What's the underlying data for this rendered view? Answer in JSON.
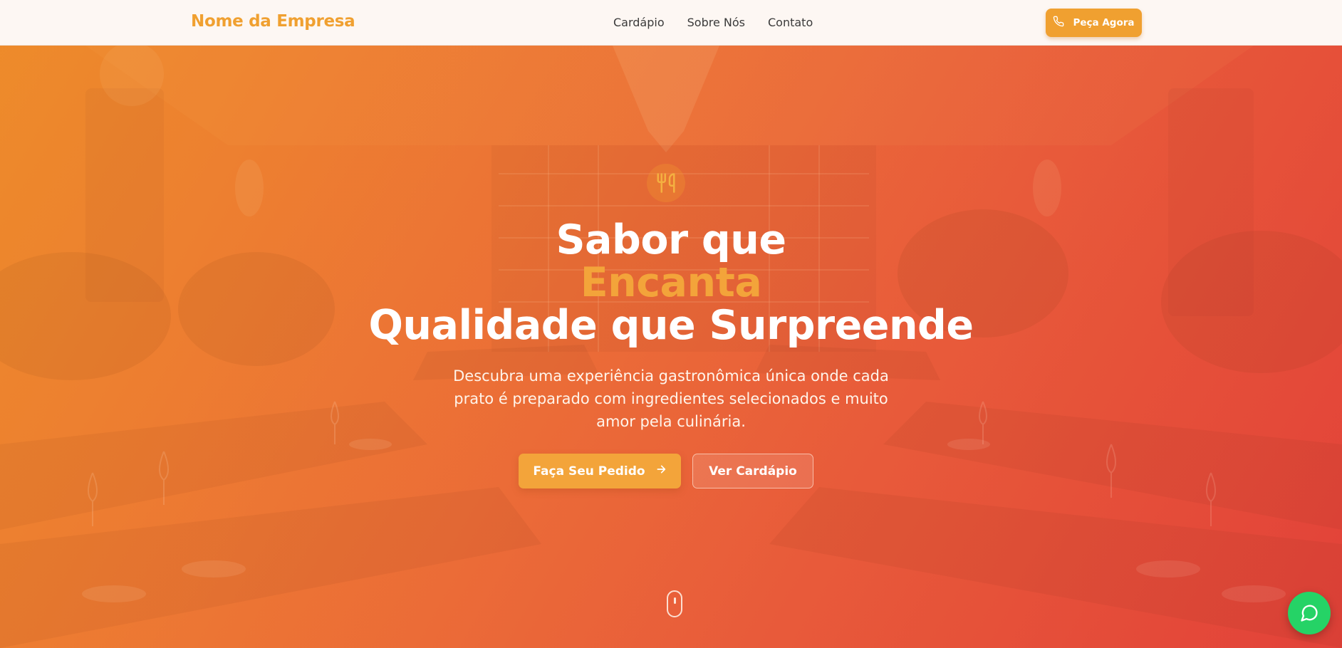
{
  "navbar": {
    "brand": "Nome da Empresa",
    "links": [
      "Cardápio",
      "Sobre Nós",
      "Contato"
    ],
    "cta_label": "Peça Agora",
    "cta_icon": "phone-icon"
  },
  "hero": {
    "emblem_icon": "utensils-icon",
    "headline_line1": "Sabor que",
    "headline_line2": "Encanta",
    "headline_line3": "Qualidade que Surpreende",
    "subtitle": "Descubra uma experiência gastronômica única onde cada prato é preparado com ingredientes selecionados e muito amor pela culinária.",
    "primary_button": "Faça Seu Pedido",
    "primary_button_icon": "arrow-right-icon",
    "secondary_button": "Ver Cardápio",
    "scroll_icon": "mouse-scroll-icon"
  },
  "floating": {
    "whatsapp_icon": "whatsapp-chat-icon"
  },
  "colors": {
    "accent": "#f0a030",
    "hero_start": "#ec8a2c",
    "hero_end": "#e2453a",
    "whatsapp": "#25d366"
  }
}
